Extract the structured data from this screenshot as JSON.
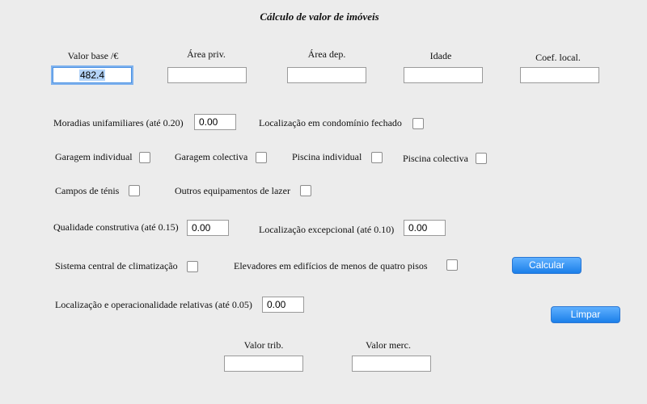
{
  "title": "Cálculo de valor de imóveis",
  "top_fields": {
    "valor_base": {
      "label": "Valor base /€",
      "value": "482.4"
    },
    "area_priv": {
      "label": "Área priv.",
      "value": ""
    },
    "area_dep": {
      "label": "Área dep.",
      "value": ""
    },
    "idade": {
      "label": "Idade",
      "value": ""
    },
    "coef_local": {
      "label": "Coef. local.",
      "value": ""
    }
  },
  "moradias": {
    "label": "Moradias unifamiliares (até 0.20)",
    "value": "0.00"
  },
  "condominio": {
    "label": "Localização em condomínio fechado",
    "checked": false
  },
  "garagem_individual": {
    "label": "Garagem individual",
    "checked": false
  },
  "garagem_colectiva": {
    "label": "Garagem colectiva",
    "checked": false
  },
  "piscina_individual": {
    "label": "Piscina individual",
    "checked": false
  },
  "piscina_colectiva": {
    "label": "Piscina colectiva",
    "checked": false
  },
  "campos_tenis": {
    "label": "Campos de ténis",
    "checked": false
  },
  "outros_lazer": {
    "label": "Outros equipamentos de lazer",
    "checked": false
  },
  "qualidade": {
    "label": "Qualidade construtiva (até 0.15)",
    "value": "0.00"
  },
  "loc_excepcional": {
    "label": "Localização excepcional (até 0.10)",
    "value": "0.00"
  },
  "climatizacao": {
    "label": "Sistema central de climatização",
    "checked": false
  },
  "elevadores": {
    "label": "Elevadores em edifícios de menos de quatro pisos",
    "checked": false
  },
  "loc_operacionalidade": {
    "label": "Localização e operacionalidade relativas (até 0.05)",
    "value": "0.00"
  },
  "buttons": {
    "calcular": "Calcular",
    "limpar": "Limpar"
  },
  "results": {
    "valor_trib": {
      "label": "Valor trib.",
      "value": ""
    },
    "valor_merc": {
      "label": "Valor merc.",
      "value": ""
    }
  },
  "colors": {
    "button": "#1b7fe9",
    "focus_ring": "#7fb2ee",
    "background": "#ececec"
  }
}
